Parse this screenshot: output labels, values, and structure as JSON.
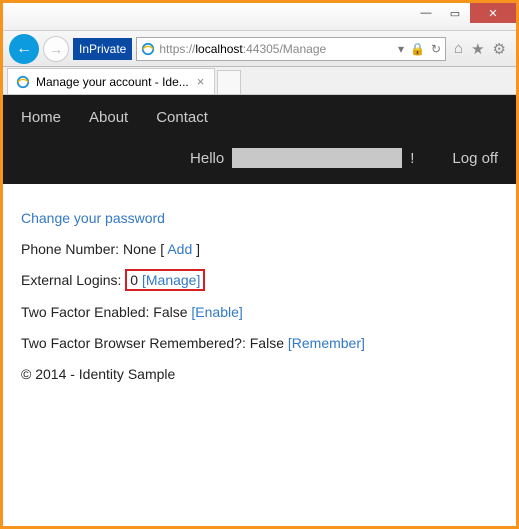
{
  "window": {
    "min": "—",
    "max": "▭",
    "close": "✕"
  },
  "address": {
    "inprivate": "InPrivate",
    "proto": "https://",
    "host": "localhost",
    "port_path": ":44305/Manage",
    "refresh_glyph": "↻",
    "lock_glyph": "🔒",
    "stop_glyph": "✕",
    "dropdown_glyph": "▾",
    "back_glyph": "←",
    "fwd_glyph": "→",
    "home_glyph": "⌂",
    "star_glyph": "★",
    "gear_glyph": "⚙"
  },
  "tab": {
    "title": "Manage your account - Ide...",
    "close": "×"
  },
  "nav": {
    "home": "Home",
    "about": "About",
    "contact": "Contact",
    "hello": "Hello",
    "exclaim": "!",
    "logoff": "Log off"
  },
  "content": {
    "change_pw": "Change your password",
    "phone_label": "Phone Number: ",
    "phone_value": "None",
    "phone_open": " [ ",
    "phone_add": "Add",
    "phone_close": " ]",
    "ext_label": "External Logins:",
    "ext_count": "0",
    "ext_manage": "[Manage]",
    "tfe_label": "Two Factor Enabled: ",
    "tfe_value": "False",
    "tfe_enable": "[Enable]",
    "tfb_label": "Two Factor Browser Remembered?: ",
    "tfb_value": "False",
    "tfb_remember": "[Remember]",
    "footer": "© 2014 - Identity Sample"
  }
}
